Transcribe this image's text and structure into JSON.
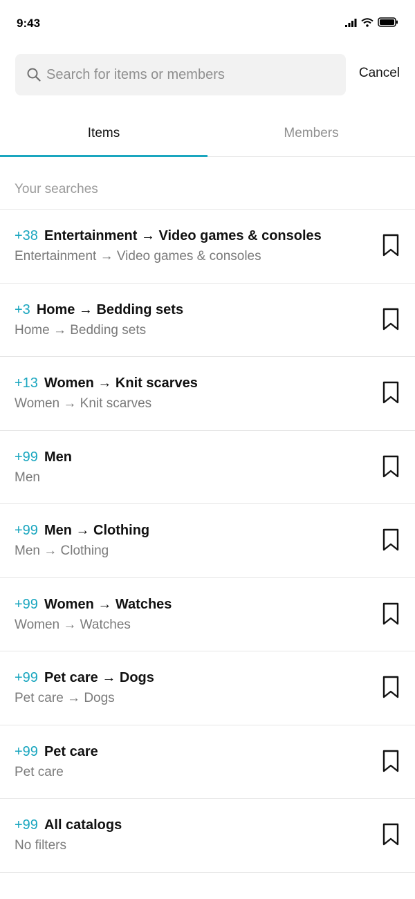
{
  "status": {
    "time": "9:43"
  },
  "search": {
    "placeholder": "Search for items or members",
    "value": "",
    "cancel_label": "Cancel"
  },
  "tabs": [
    {
      "label": "Items",
      "active": true
    },
    {
      "label": "Members",
      "active": false
    }
  ],
  "section": {
    "title": "Your searches"
  },
  "accent_color": "#1aa6bf",
  "saved_searches": [
    {
      "count": "+38",
      "title": "Entertainment → Video games & consoles",
      "subtitle": "Entertainment → Video games & consoles"
    },
    {
      "count": "+3",
      "title": "Home → Bedding sets",
      "subtitle": "Home → Bedding sets"
    },
    {
      "count": "+13",
      "title": "Women → Knit scarves",
      "subtitle": "Women → Knit scarves"
    },
    {
      "count": "+99",
      "title": "Men",
      "subtitle": "Men"
    },
    {
      "count": "+99",
      "title": "Men → Clothing",
      "subtitle": "Men → Clothing"
    },
    {
      "count": "+99",
      "title": "Women → Watches",
      "subtitle": "Women → Watches"
    },
    {
      "count": "+99",
      "title": "Pet care → Dogs",
      "subtitle": "Pet care → Dogs"
    },
    {
      "count": "+99",
      "title": "Pet care",
      "subtitle": "Pet care"
    },
    {
      "count": "+99",
      "title": "All catalogs",
      "subtitle": "No filters"
    }
  ]
}
